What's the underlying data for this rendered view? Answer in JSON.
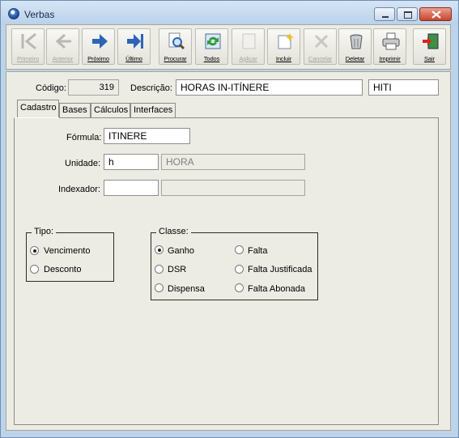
{
  "window": {
    "title": "Verbas"
  },
  "toolbar": {
    "buttons": [
      {
        "label": "Primeiro",
        "icon": "first-record-icon",
        "enabled": false
      },
      {
        "label": "Anterior",
        "icon": "previous-record-icon",
        "enabled": false
      },
      {
        "label": "Próximo",
        "icon": "next-record-icon",
        "enabled": true
      },
      {
        "label": "Último",
        "icon": "last-record-icon",
        "enabled": true
      },
      {
        "label": "Procurar",
        "icon": "search-icon",
        "enabled": true
      },
      {
        "label": "Todos",
        "icon": "refresh-all-icon",
        "enabled": true
      },
      {
        "label": "Aplicar",
        "icon": "apply-icon",
        "enabled": false
      },
      {
        "label": "Incluir",
        "icon": "new-record-icon",
        "enabled": true
      },
      {
        "label": "Cancelar",
        "icon": "cancel-icon",
        "enabled": false
      },
      {
        "label": "Deletar",
        "icon": "trash-icon",
        "enabled": true
      },
      {
        "label": "Imprimir",
        "icon": "printer-icon",
        "enabled": true
      },
      {
        "label": "Sair",
        "icon": "exit-door-icon",
        "enabled": true
      }
    ]
  },
  "header": {
    "codigo_label": "Código:",
    "codigo_value": "319",
    "descricao_label": "Descrição:",
    "descricao_value": "HORAS IN-ITÍNERE",
    "abreviacao_value": "HITI"
  },
  "tabs": [
    {
      "label": "Cadastro",
      "active": true
    },
    {
      "label": "Bases",
      "active": false
    },
    {
      "label": "Cálculos",
      "active": false
    },
    {
      "label": "Interfaces",
      "active": false
    }
  ],
  "form": {
    "formula_label": "Fórmula:",
    "formula_value": "ITINERE",
    "unidade_label": "Unidade:",
    "unidade_code": "h",
    "unidade_desc": "HORA",
    "indexador_label": "Indexador:",
    "indexador_code": "",
    "indexador_desc": ""
  },
  "tipo": {
    "title": "Tipo:",
    "options": [
      {
        "label": "Vencimento",
        "checked": true
      },
      {
        "label": "Desconto",
        "checked": false
      }
    ]
  },
  "classe": {
    "title": "Classe:",
    "options": [
      {
        "label": "Ganho",
        "checked": true
      },
      {
        "label": "DSR",
        "checked": false
      },
      {
        "label": "Dispensa",
        "checked": false
      },
      {
        "label": "Falta",
        "checked": false
      },
      {
        "label": "Falta Justificada",
        "checked": false
      },
      {
        "label": "Falta Abonada",
        "checked": false
      }
    ]
  },
  "colors": {
    "title_bar": "#bcd3ea",
    "close_button": "#c8442d",
    "panel_bg": "#ecebe4",
    "arrow_blue": "#2d64b8"
  }
}
